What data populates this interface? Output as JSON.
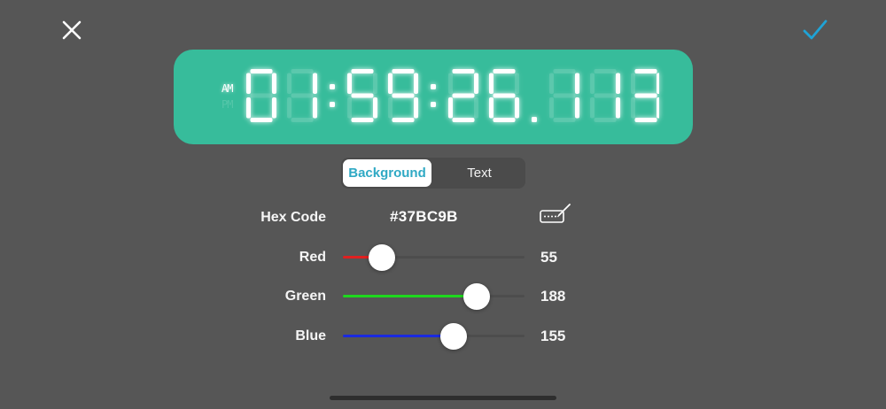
{
  "header": {
    "close_icon": "close-icon",
    "confirm_icon": "checkmark-icon",
    "confirm_color": "#1fa3d6"
  },
  "clock": {
    "am_label": "AM",
    "pm_label": "PM",
    "active_period": "AM",
    "time_display": "01:59:26.113",
    "background_color": "#37BC9B"
  },
  "tabs": {
    "background_label": "Background",
    "text_label": "Text",
    "selected": "Background"
  },
  "hex": {
    "label": "Hex Code",
    "value": "#37BC9B",
    "edit_icon": "keyboard-edit-icon"
  },
  "sliders": {
    "red": {
      "label": "Red",
      "value": "55",
      "max": 255,
      "color": "#e02020"
    },
    "green": {
      "label": "Green",
      "value": "188",
      "max": 255,
      "color": "#1ed81e"
    },
    "blue": {
      "label": "Blue",
      "value": "155",
      "max": 255,
      "color": "#1a2ae0"
    }
  }
}
